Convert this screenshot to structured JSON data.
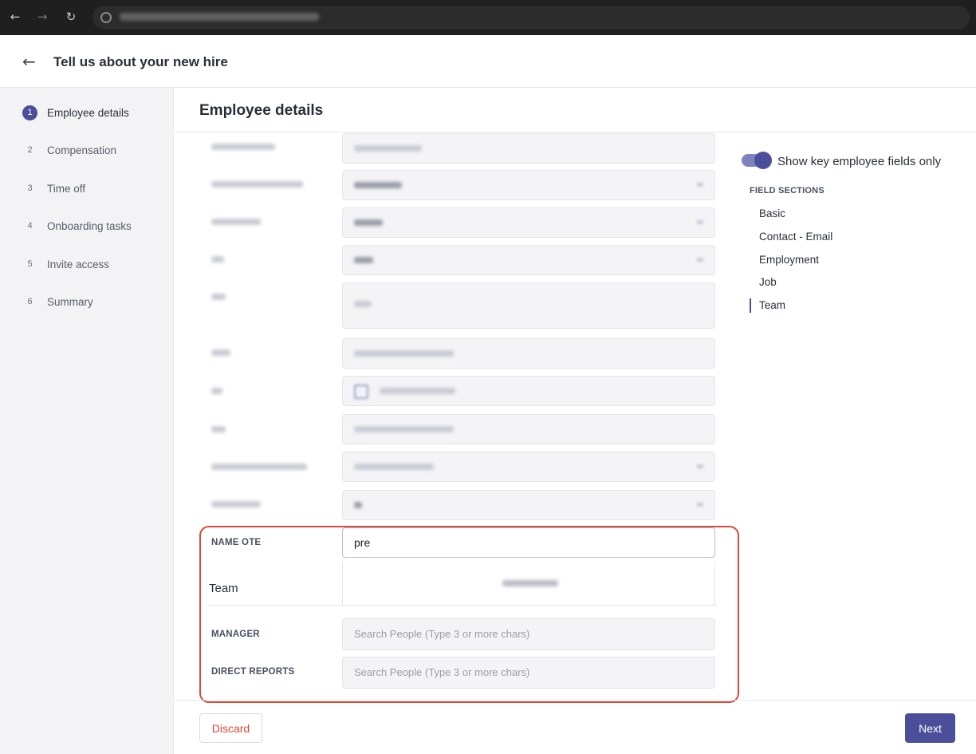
{
  "header": {
    "title": "Tell us about your new hire"
  },
  "sidebar": {
    "steps": [
      {
        "num": "1",
        "label": "Employee details"
      },
      {
        "num": "2",
        "label": "Compensation"
      },
      {
        "num": "3",
        "label": "Time off"
      },
      {
        "num": "4",
        "label": "Onboarding tasks"
      },
      {
        "num": "5",
        "label": "Invite access"
      },
      {
        "num": "6",
        "label": "Summary"
      }
    ],
    "active_step": 1
  },
  "main": {
    "title": "Employee details",
    "name_ote": {
      "label": "NAME OTE",
      "value": "pre"
    },
    "team": {
      "label": "Team"
    },
    "manager": {
      "label": "MANAGER",
      "placeholder": "Search People (Type 3 or more chars)"
    },
    "direct_reports": {
      "label": "DIRECT REPORTS",
      "placeholder": "Search People (Type 3 or more chars)"
    }
  },
  "right_panel": {
    "toggle_label": "Show key employee fields only",
    "toggle_on": true,
    "field_sections_heading": "FIELD SECTIONS",
    "sections": [
      "Basic",
      "Contact - Email",
      "Employment",
      "Job",
      "Team"
    ],
    "active_section": "Team"
  },
  "footer": {
    "discard_label": "Discard",
    "next_label": "Next"
  },
  "colors": {
    "accent": "#4b4f9a",
    "danger": "#d9493a",
    "highlight": "#d9493a"
  }
}
